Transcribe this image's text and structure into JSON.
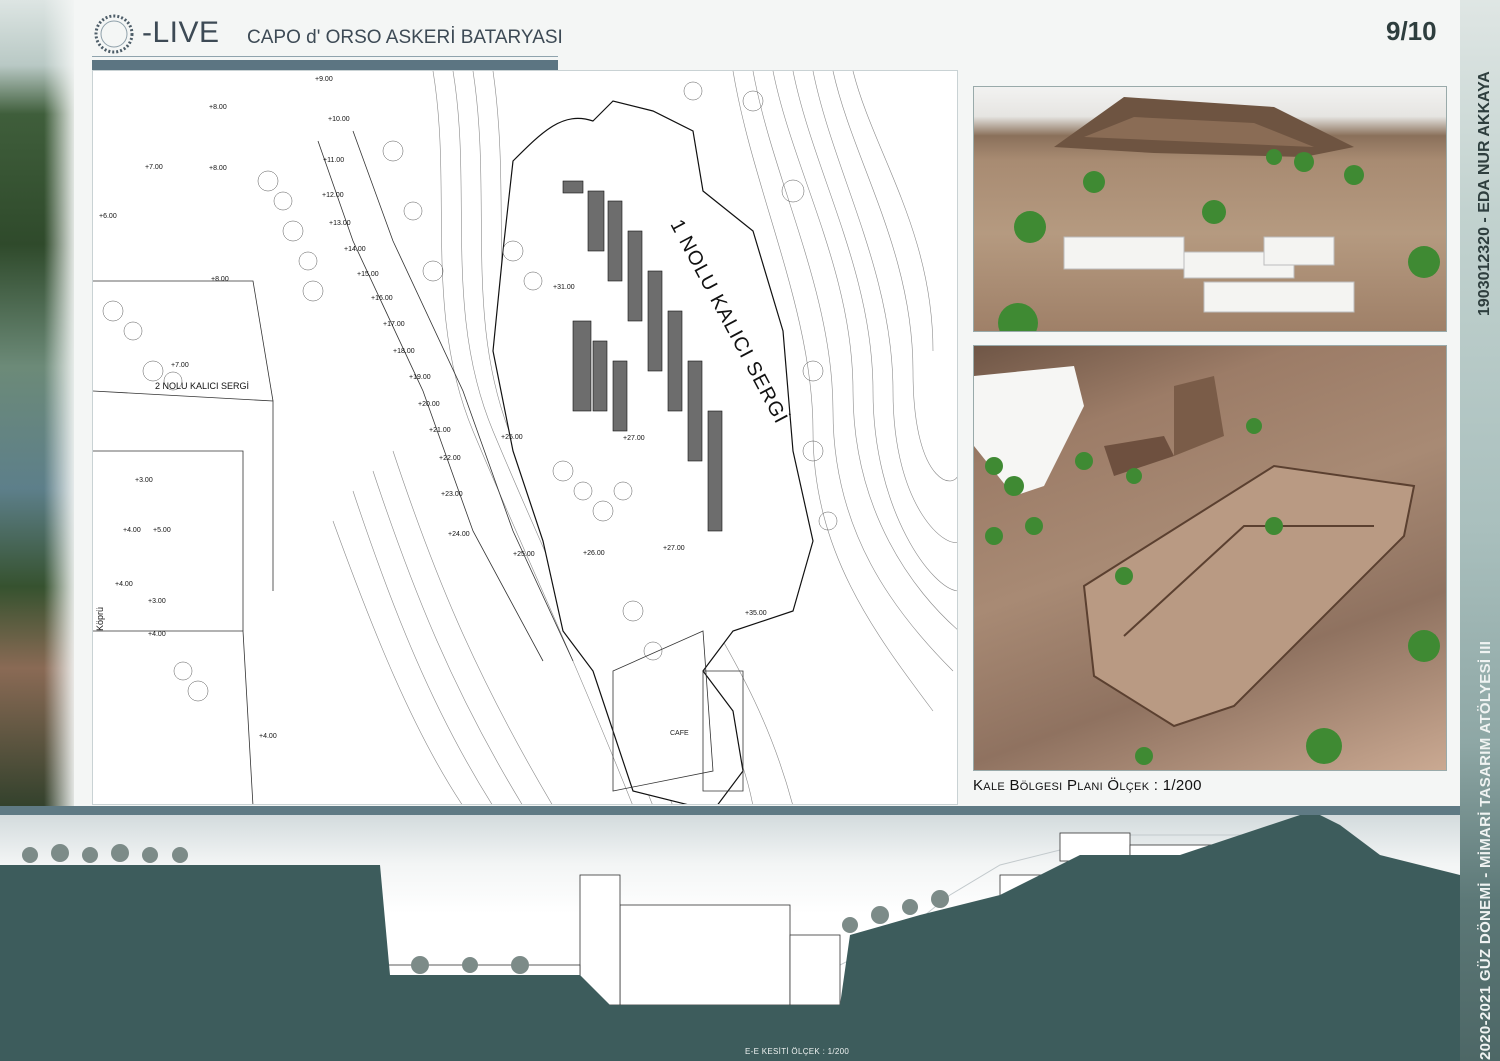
{
  "header": {
    "brand": "-LIVE",
    "subtitle": "CAPO d' ORSO ASKERİ BATARYASI",
    "page": "9/10"
  },
  "side": {
    "author": "1903012320 - EDA NUR AKKAYA",
    "course": "2020-2021 GÜZ DÖNEMİ - MİMARİ TASARIM ATÖLYESİ III"
  },
  "plan": {
    "exhibit1_label": "1 NOLU KALICI SERGİ",
    "exhibit2_label": "2 NOLU KALICI SERGİ",
    "bridge_label": "Köprü",
    "cafe_label": "CAFE",
    "elevations": [
      "+9.00",
      "+8.00",
      "+10.00",
      "+11.00",
      "+7.00",
      "+8.00",
      "+12.00",
      "+6.00",
      "+13.00",
      "+14.00",
      "+15.00",
      "+8.00",
      "+16.00",
      "+17.00",
      "+7.00",
      "+18.00",
      "+19.00",
      "+20.00",
      "+21.00",
      "+22.00",
      "+23.00",
      "+24.00",
      "+25.00",
      "+26.00",
      "+27.00",
      "+27.00",
      "+25.00",
      "+31.00",
      "+35.00",
      "+3.00",
      "+4.00",
      "+5.00",
      "+4.00",
      "+3.00",
      "+4.00",
      "+4.00"
    ]
  },
  "captions": {
    "plan_prefix": "Kale Bölgesi Planı Ölçek",
    "plan_scale": ": 1/200",
    "section": "E-E  KESİTİ ÖLÇEK : 1/200"
  }
}
